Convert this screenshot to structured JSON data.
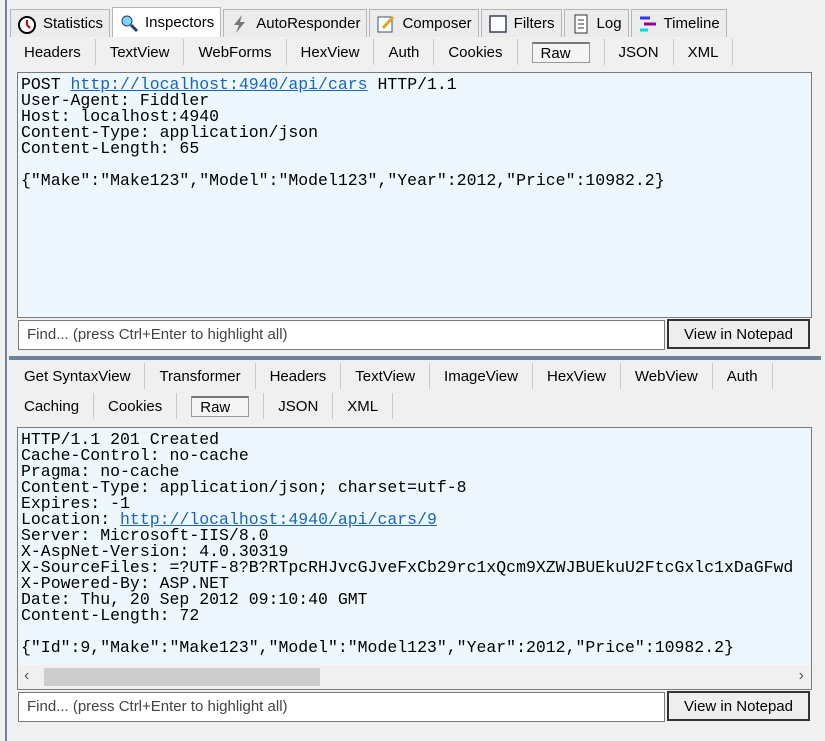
{
  "main_tabs": [
    {
      "label": "Statistics",
      "icon": "stopwatch-icon"
    },
    {
      "label": "Inspectors",
      "icon": "inspect-icon",
      "active": true
    },
    {
      "label": "AutoResponder",
      "icon": "lightning-icon"
    },
    {
      "label": "Composer",
      "icon": "compose-icon"
    },
    {
      "label": "Filters",
      "icon": "checkbox-icon"
    },
    {
      "label": "Log",
      "icon": "log-icon"
    },
    {
      "label": "Timeline",
      "icon": "timeline-icon"
    }
  ],
  "request": {
    "tabs": [
      "Headers",
      "TextView",
      "WebForms",
      "HexView",
      "Auth",
      "Cookies",
      "Raw",
      "JSON",
      "XML"
    ],
    "selected": "Raw",
    "line1_method": "POST",
    "line1_url": "http://localhost:4940/api/cars",
    "line1_proto": "HTTP/1.1",
    "lines": [
      "User-Agent: Fiddler",
      "Host: localhost:4940",
      "Content-Type: application/json",
      "Content-Length: 65",
      "",
      "{\"Make\":\"Make123\",\"Model\":\"Model123\",\"Year\":2012,\"Price\":10982.2}"
    ],
    "find_placeholder": "Find... (press Ctrl+Enter to highlight all)",
    "notepad_label": "View in Notepad"
  },
  "response": {
    "tabs_row1": [
      "Get SyntaxView",
      "Transformer",
      "Headers",
      "TextView",
      "ImageView",
      "HexView",
      "WebView",
      "Auth"
    ],
    "tabs_row2": [
      "Caching",
      "Cookies",
      "Raw",
      "JSON",
      "XML"
    ],
    "selected": "Raw",
    "lines_before": [
      "HTTP/1.1 201 Created",
      "Cache-Control: no-cache",
      "Pragma: no-cache",
      "Content-Type: application/json; charset=utf-8",
      "Expires: -1"
    ],
    "location_label": "Location: ",
    "location_url": "http://localhost:4940/api/cars/9",
    "lines_after": [
      "Server: Microsoft-IIS/8.0",
      "X-AspNet-Version: 4.0.30319",
      "X-SourceFiles: =?UTF-8?B?RTpcRHJvcGJveFxCb29rc1xQcm9XZWJBUEkuU2FtcGxlc1xDaGFwd",
      "X-Powered-By: ASP.NET",
      "Date: Thu, 20 Sep 2012 09:10:40 GMT",
      "Content-Length: 72",
      "",
      "{\"Id\":9,\"Make\":\"Make123\",\"Model\":\"Model123\",\"Year\":2012,\"Price\":10982.2}"
    ],
    "find_placeholder": "Find... (press Ctrl+Enter to highlight all)",
    "notepad_label": "View in Notepad",
    "scroll_left": "‹",
    "scroll_right": "›"
  }
}
